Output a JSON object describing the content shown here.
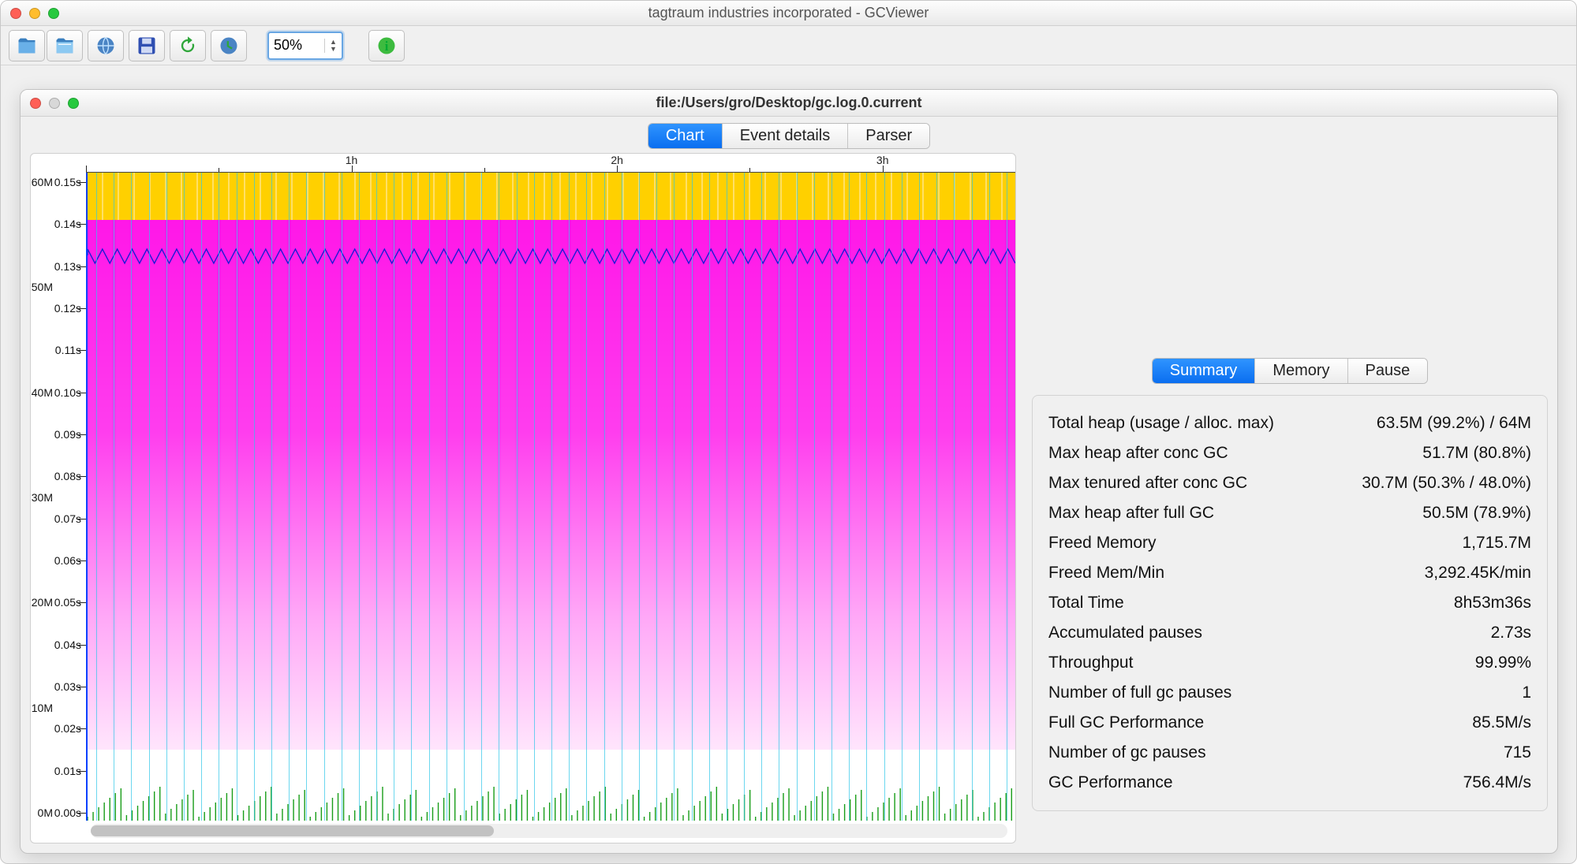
{
  "window": {
    "title": "tagtraum industries incorporated - GCViewer"
  },
  "toolbar": {
    "zoom_value": "50%"
  },
  "doc": {
    "title": "file:/Users/gro/Desktop/gc.log.0.current",
    "tabs": {
      "chart": "Chart",
      "event_details": "Event details",
      "parser": "Parser"
    }
  },
  "side_tabs": {
    "summary": "Summary",
    "memory": "Memory",
    "pause": "Pause"
  },
  "summary": {
    "rows": [
      {
        "label": "Total heap (usage / alloc. max)",
        "value": "63.5M (99.2%) / 64M"
      },
      {
        "label": "Max heap after conc GC",
        "value": "51.7M (80.8%)"
      },
      {
        "label": "Max tenured after conc GC",
        "value": "30.7M (50.3% / 48.0%)"
      },
      {
        "label": "Max heap after full GC",
        "value": "50.5M (78.9%)"
      },
      {
        "label": "Freed Memory",
        "value": "1,715.7M"
      },
      {
        "label": "Freed Mem/Min",
        "value": "3,292.45K/min"
      },
      {
        "label": "Total Time",
        "value": "8h53m36s"
      },
      {
        "label": "Accumulated pauses",
        "value": "2.73s"
      },
      {
        "label": "Throughput",
        "value": "99.99%"
      },
      {
        "label": "Number of full gc pauses",
        "value": "1"
      },
      {
        "label": "Full GC Performance",
        "value": "85.5M/s"
      },
      {
        "label": "Number of gc pauses",
        "value": "715"
      },
      {
        "label": "GC Performance",
        "value": "756.4M/s"
      }
    ]
  },
  "chart_data": {
    "type": "area",
    "title": "",
    "x_axis": {
      "unit": "hours",
      "ticks": [
        "0",
        "1h",
        "2h",
        "3h"
      ],
      "visible_range_end_approx": "3.5h"
    },
    "y_left_memory": {
      "unit": "MB",
      "ticks": [
        "0M",
        "10M",
        "20M",
        "30M",
        "40M",
        "50M",
        "60M"
      ],
      "ylim": [
        0,
        64
      ]
    },
    "y_left_pause": {
      "unit": "seconds",
      "ticks": [
        "0.00s",
        "0.01s",
        "0.02s",
        "0.03s",
        "0.04s",
        "0.05s",
        "0.06s",
        "0.07s",
        "0.08s",
        "0.09s",
        "0.10s",
        "0.11s",
        "0.12s",
        "0.13s",
        "0.14s",
        "0.15s"
      ],
      "ylim": [
        0,
        0.15
      ]
    },
    "heap_total_mb": 64,
    "heap_used_band_top_mb": 63.5,
    "heap_used_band_bottom_mb": 60,
    "used_heap_envelope_mb": {
      "min": 51,
      "max": 55,
      "description": "used heap oscillates ~51–55 MB across full range"
    },
    "gc_pause_baseline_s_range": [
      0.0,
      0.02
    ],
    "periodic_vertical_lines_approx_count": 53,
    "notes": "Chart shows allocated heap (yellow ~60–64M band), used heap as magenta area nearly flat around 52M with fine sawtooth ~±2M; dense cyan vertical lines mark minor GCs; green spikes at bottom are young-gc pauses < ~0.02s; scrollbar thumb covers roughly first 44% of total 8h53m history."
  }
}
